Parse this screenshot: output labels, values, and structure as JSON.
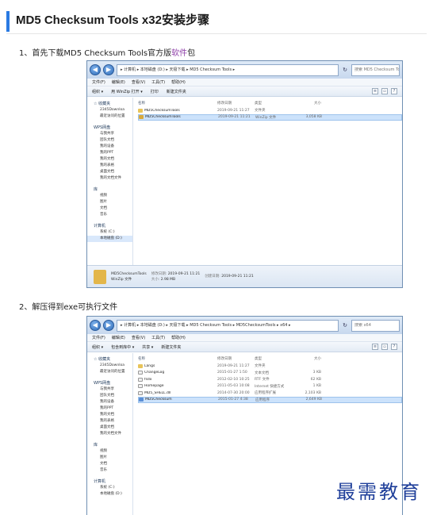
{
  "article": {
    "title": "MD5 Checksum Tools x32安装步骤",
    "step1": {
      "prefix": "1、首先下载MD5 Checksum Tools官方版",
      "keyword": "软件",
      "suffix": "包"
    },
    "step2": {
      "text": "2、解压得到exe可执行文件"
    }
  },
  "window1": {
    "address": "▸ 计算机 ▸ 本地磁盘 (D:) ▸ 天极下载 ▸ MD5 Checksum Tools ▸",
    "search_placeholder": "搜索 MD5 Checksum Tools",
    "menu": [
      "文件(F)",
      "编辑(E)",
      "查看(V)",
      "工具(T)",
      "帮助(H)"
    ],
    "toolbar": [
      "组织 ▾",
      "用 WinZip 打开 ▾",
      "打印",
      "新建文件夹"
    ],
    "nav": [
      {
        "kind": "group",
        "label": "☆ 收藏夹"
      },
      {
        "kind": "item",
        "label": "2345Downloa"
      },
      {
        "kind": "item",
        "label": "最近访问的位置"
      },
      {
        "kind": "gap"
      },
      {
        "kind": "group",
        "label": "WPS网盘"
      },
      {
        "kind": "item",
        "label": "与我共享"
      },
      {
        "kind": "item",
        "label": "团队文档"
      },
      {
        "kind": "item",
        "label": "我的设备"
      },
      {
        "kind": "item",
        "label": "我的PPT"
      },
      {
        "kind": "item",
        "label": "我的文档"
      },
      {
        "kind": "item",
        "label": "我的表格"
      },
      {
        "kind": "item",
        "label": "桌面文档"
      },
      {
        "kind": "item",
        "label": "我的文档文件"
      },
      {
        "kind": "gap"
      },
      {
        "kind": "group",
        "label": "库"
      },
      {
        "kind": "item",
        "label": "视频"
      },
      {
        "kind": "item",
        "label": "图片"
      },
      {
        "kind": "item",
        "label": "文档"
      },
      {
        "kind": "item",
        "label": "音乐"
      },
      {
        "kind": "gap"
      },
      {
        "kind": "group",
        "label": "计算机"
      },
      {
        "kind": "item",
        "label": "系统 (C:)"
      },
      {
        "kind": "item",
        "label": "本地磁盘 (D:)",
        "selected": true
      }
    ],
    "columns": [
      "名称",
      "修改日期",
      "类型",
      "大小"
    ],
    "files": [
      {
        "icon": "folder",
        "name": "MD5ChecksumTools",
        "date": "2019-09-21 11:27",
        "type": "文件夹",
        "size": "",
        "selected": false
      },
      {
        "icon": "zip",
        "name": "MD5ChecksumTools",
        "date": "2019-09-21 11:21",
        "type": "WinZip 文件",
        "size": "3,058 KB",
        "selected": true
      }
    ],
    "details": {
      "name": "MD5ChecksumTools",
      "modified_label": "修改日期:",
      "modified": "2019-09-21 11:21",
      "created_label": "创建日期:",
      "created": "2019-09-21 11:21",
      "type": "WinZip 文件",
      "size_label": "大小:",
      "size": "2.98 MB"
    }
  },
  "window2": {
    "address": "▸ 计算机 ▸ 本地磁盘 (D:) ▸ 天极下载 ▸ MD5 Checksum Tools ▸ MD5ChecksumTools ▸ x64 ▸",
    "search_placeholder": "搜索 x64",
    "menu": [
      "文件(F)",
      "编辑(E)",
      "查看(V)",
      "工具(T)",
      "帮助(H)"
    ],
    "toolbar": [
      "组织 ▾",
      "包含到库中 ▾",
      "共享 ▾",
      "新建文件夹"
    ],
    "nav": [
      {
        "kind": "group",
        "label": "☆ 收藏夹"
      },
      {
        "kind": "item",
        "label": "2345Downloa"
      },
      {
        "kind": "item",
        "label": "最近访问的位置"
      },
      {
        "kind": "gap"
      },
      {
        "kind": "group",
        "label": "WPS网盘"
      },
      {
        "kind": "item",
        "label": "与我共享"
      },
      {
        "kind": "item",
        "label": "团队文档"
      },
      {
        "kind": "item",
        "label": "我的设备"
      },
      {
        "kind": "item",
        "label": "我的PPT"
      },
      {
        "kind": "item",
        "label": "我的文档"
      },
      {
        "kind": "item",
        "label": "我的表格"
      },
      {
        "kind": "item",
        "label": "桌面文档"
      },
      {
        "kind": "item",
        "label": "我的文档文件"
      },
      {
        "kind": "gap"
      },
      {
        "kind": "group",
        "label": "库"
      },
      {
        "kind": "item",
        "label": "视频"
      },
      {
        "kind": "item",
        "label": "图片"
      },
      {
        "kind": "item",
        "label": "文档"
      },
      {
        "kind": "item",
        "label": "音乐"
      },
      {
        "kind": "gap"
      },
      {
        "kind": "group",
        "label": "计算机"
      },
      {
        "kind": "item",
        "label": "系统 (C:)"
      },
      {
        "kind": "item",
        "label": "本地磁盘 (D:)"
      }
    ],
    "columns": [
      "名称",
      "修改日期",
      "类型",
      "大小"
    ],
    "files": [
      {
        "icon": "folder",
        "name": "Langs",
        "date": "2019-09-21 11:27",
        "type": "文件夹",
        "size": "",
        "selected": false
      },
      {
        "icon": "doc",
        "name": "ChangeLog",
        "date": "2015-01-27 1:50",
        "type": "文本文档",
        "size": "3 KB",
        "selected": false
      },
      {
        "icon": "doc",
        "name": "fsdx",
        "date": "2012-02-10 10:25",
        "type": "RTF 文件",
        "size": "62 KB",
        "selected": false
      },
      {
        "icon": "doc",
        "name": "Homepage",
        "date": "2011-05-03 10:08",
        "type": "Internet 快捷方式",
        "size": "1 KB",
        "selected": false
      },
      {
        "icon": "doc",
        "name": "MD5_SHELL.dll",
        "date": "2014-07-30 20:00",
        "type": "应用程序扩展",
        "size": "2,103 KB",
        "selected": false
      },
      {
        "icon": "app",
        "name": "MD5Checksum",
        "date": "2015-01-27 4:38",
        "type": "应用程序",
        "size": "2,649 KB",
        "selected": true
      }
    ]
  },
  "watermark": "最需教育",
  "colors": {
    "accent": "#2a7ae2",
    "keyword": "#8e3fa8",
    "watermark": "#1f3f9a"
  }
}
